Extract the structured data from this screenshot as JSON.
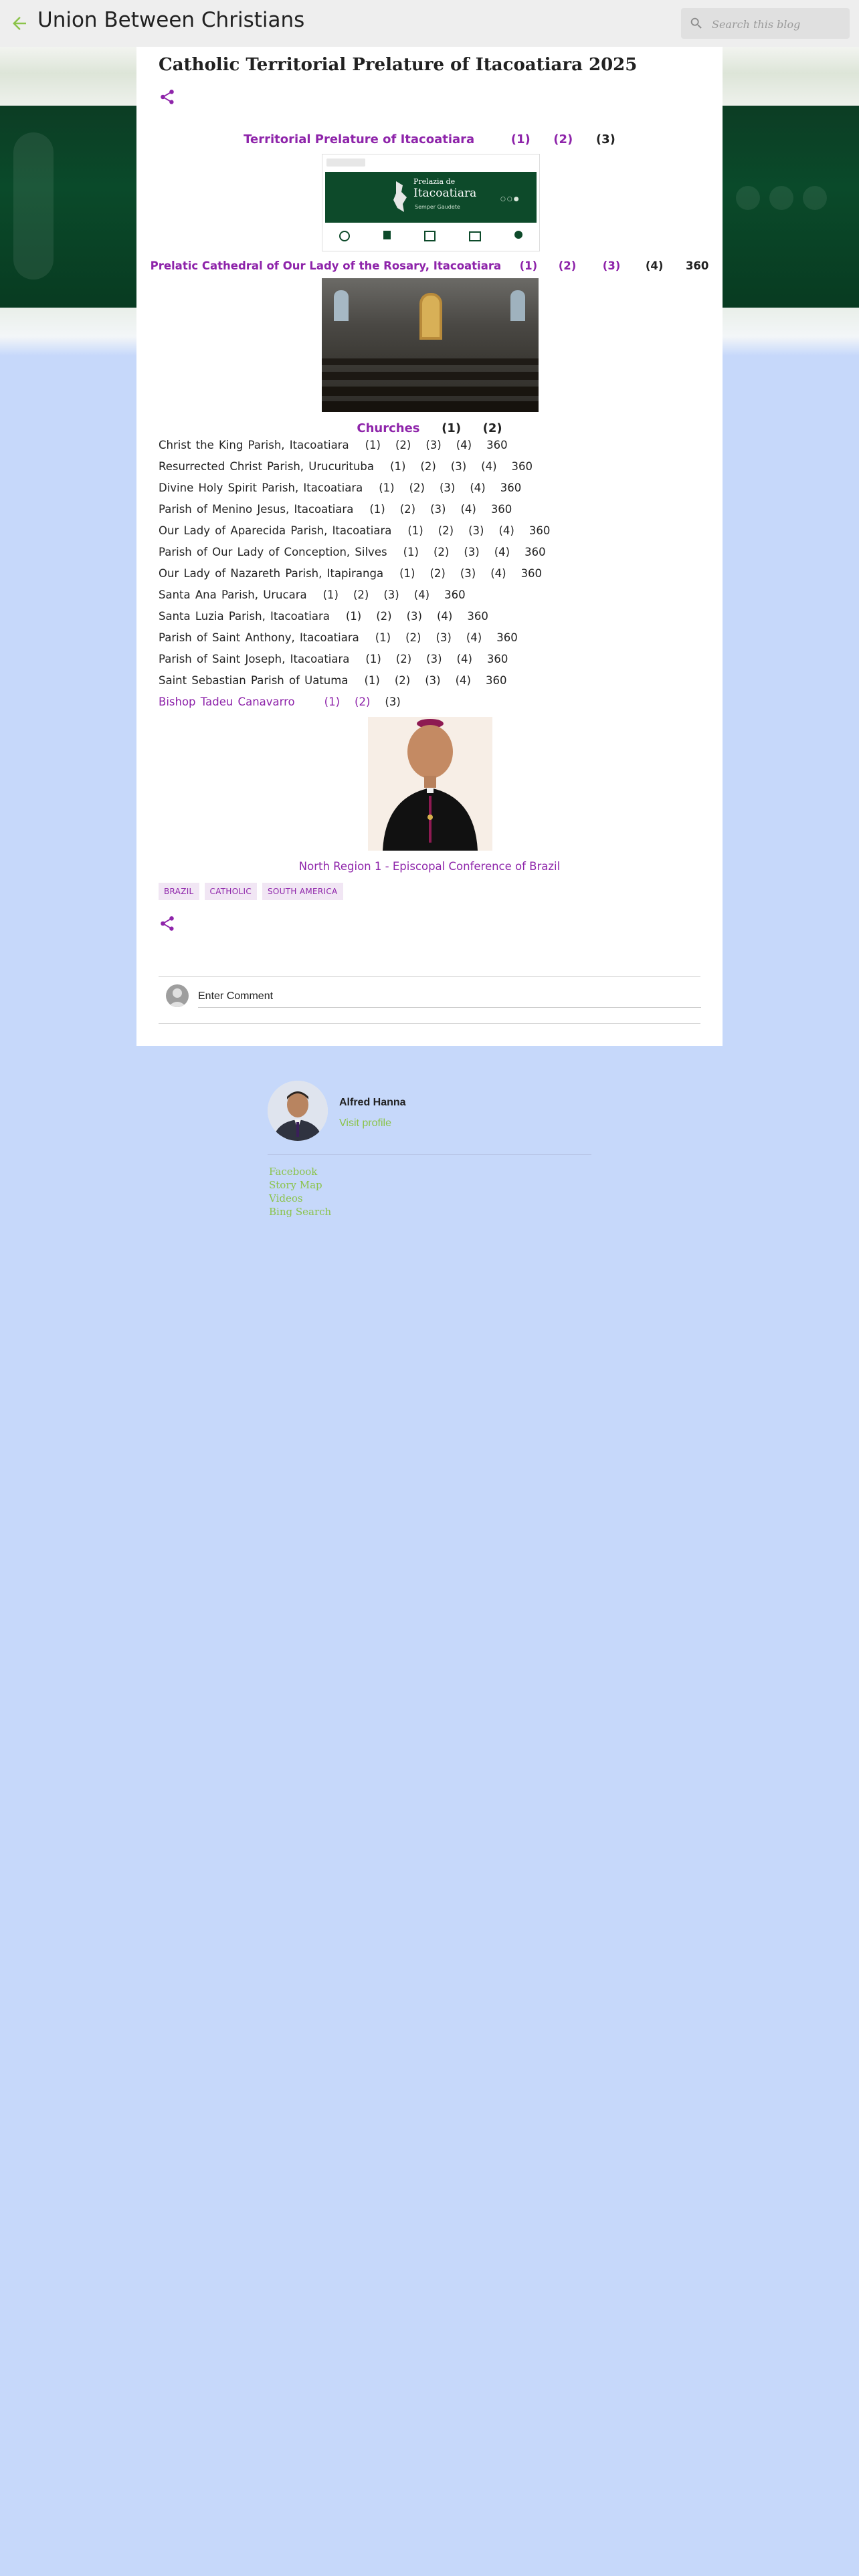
{
  "app": {
    "title": "Union Between Christians",
    "search_placeholder": "Search this blog",
    "accent_color": "#8e24aa",
    "link_green": "#8bc34a",
    "background": "#c6d8fa"
  },
  "post": {
    "title": "Catholic Territorial Prelature of Itacoatiara 2025",
    "prelature": {
      "name": "Territorial Prelature of Itacoatiara",
      "links": [
        "(1)",
        "(2)"
      ],
      "extra": "(3)"
    },
    "prelature_image": {
      "heading1": "Prelazia de",
      "heading2": "Itacoatiara",
      "subtitle": "Semper Gaudete",
      "icons": [
        "nav-item-1",
        "nav-item-2",
        "nav-item-3",
        "nav-item-4",
        "nav-item-5"
      ]
    },
    "cathedral": {
      "name": "Prelatic Cathedral of Our Lady of the Rosary, Itacoatiara",
      "links": [
        "(1)",
        "(2)",
        "(3)"
      ],
      "extra": [
        "(4)",
        "360"
      ]
    },
    "churches": {
      "label": "Churches",
      "links": [
        "(1)",
        "(2)"
      ]
    },
    "parishes": [
      {
        "name": "Christ the King Parish, Itacoatiara",
        "refs": [
          "(1)",
          "(2)",
          "(3)",
          "(4)",
          "360"
        ]
      },
      {
        "name": "Resurrected Christ Parish, Urucurituba",
        "refs": [
          "(1)",
          "(2)",
          "(3)",
          "(4)",
          "360"
        ]
      },
      {
        "name": "Divine Holy Spirit Parish, Itacoatiara",
        "refs": [
          "(1)",
          "(2)",
          "(3)",
          "(4)",
          "360"
        ]
      },
      {
        "name": "Parish of Menino Jesus, Itacoatiara",
        "refs": [
          "(1)",
          "(2)",
          "(3)",
          "(4)",
          "360"
        ]
      },
      {
        "name": "Our Lady of Aparecida Parish, Itacoatiara",
        "refs": [
          "(1)",
          "(2)",
          "(3)",
          "(4)",
          "360"
        ]
      },
      {
        "name": "Parish of Our Lady of Conception, Silves",
        "refs": [
          "(1)",
          "(2)",
          "(3)",
          "(4)",
          "360"
        ]
      },
      {
        "name": "Our Lady of Nazareth Parish, Itapiranga",
        "refs": [
          "(1)",
          "(2)",
          "(3)",
          "(4)",
          "360"
        ]
      },
      {
        "name": "Santa Ana Parish, Urucara",
        "refs": [
          "(1)",
          "(2)",
          "(3)",
          "(4)",
          "360"
        ]
      },
      {
        "name": "Santa Luzia Parish, Itacoatiara",
        "refs": [
          "(1)",
          "(2)",
          "(3)",
          "(4)",
          "360"
        ]
      },
      {
        "name": "Parish of Saint Anthony, Itacoatiara",
        "refs": [
          "(1)",
          "(2)",
          "(3)",
          "(4)",
          "360"
        ]
      },
      {
        "name": "Parish of Saint Joseph, Itacoatiara",
        "refs": [
          "(1)",
          "(2)",
          "(3)",
          "(4)",
          "360"
        ]
      },
      {
        "name": "Saint Sebastian Parish of Uatuma",
        "refs": [
          "(1)",
          "(2)",
          "(3)",
          "(4)",
          "360"
        ]
      }
    ],
    "bishop": {
      "name": "Bishop Tadeu Canavarro",
      "links": [
        "(1)",
        "(2)"
      ],
      "extra": "(3)"
    },
    "region_link": "North Region 1 - Episcopal Conference of Brazil",
    "labels": [
      "BRAZIL",
      "CATHOLIC",
      "SOUTH AMERICA"
    ],
    "comment_placeholder": "Enter Comment"
  },
  "profile": {
    "name": "Alfred Hanna",
    "visit_label": "Visit profile"
  },
  "footer_links": [
    "Facebook",
    "Story Map",
    "Videos",
    "Bing Search"
  ]
}
